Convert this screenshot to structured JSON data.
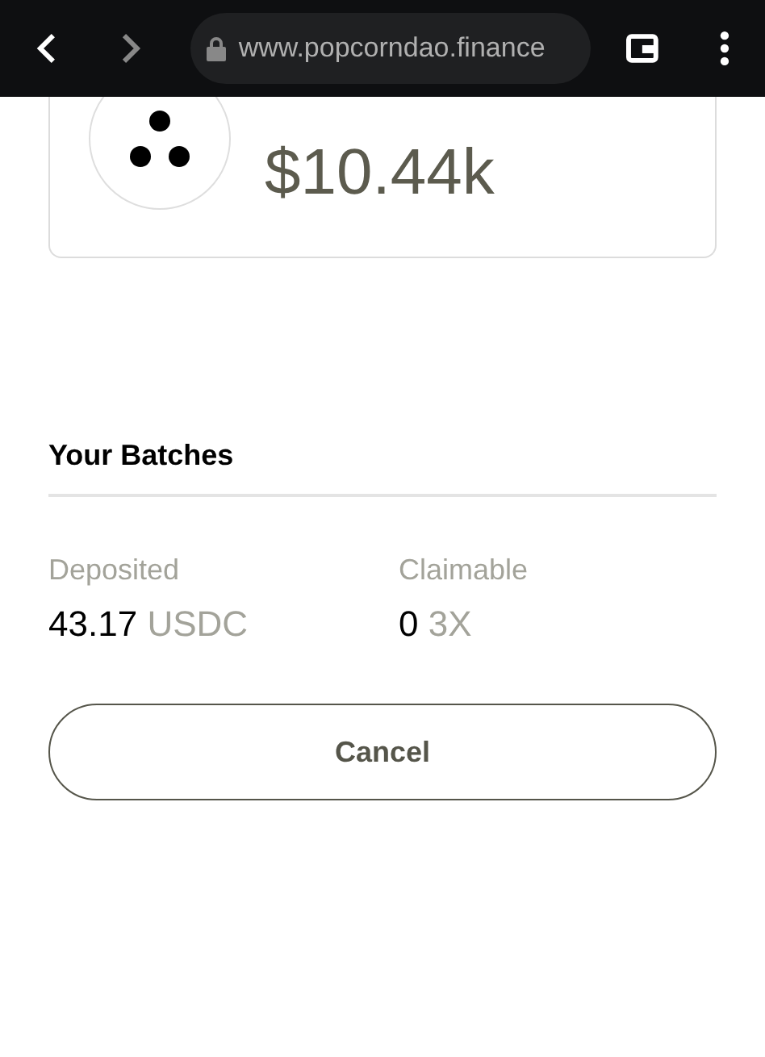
{
  "browser": {
    "url": "www.popcorndao.finance"
  },
  "vault_card": {
    "value": "$10.44k"
  },
  "batches": {
    "title": "Your Batches",
    "stats": [
      {
        "label": "Deposited",
        "amount": "43.17",
        "unit": "USDC"
      },
      {
        "label": "Claimable",
        "amount": "0",
        "unit": "3X"
      }
    ],
    "cancel_button": "Cancel"
  }
}
